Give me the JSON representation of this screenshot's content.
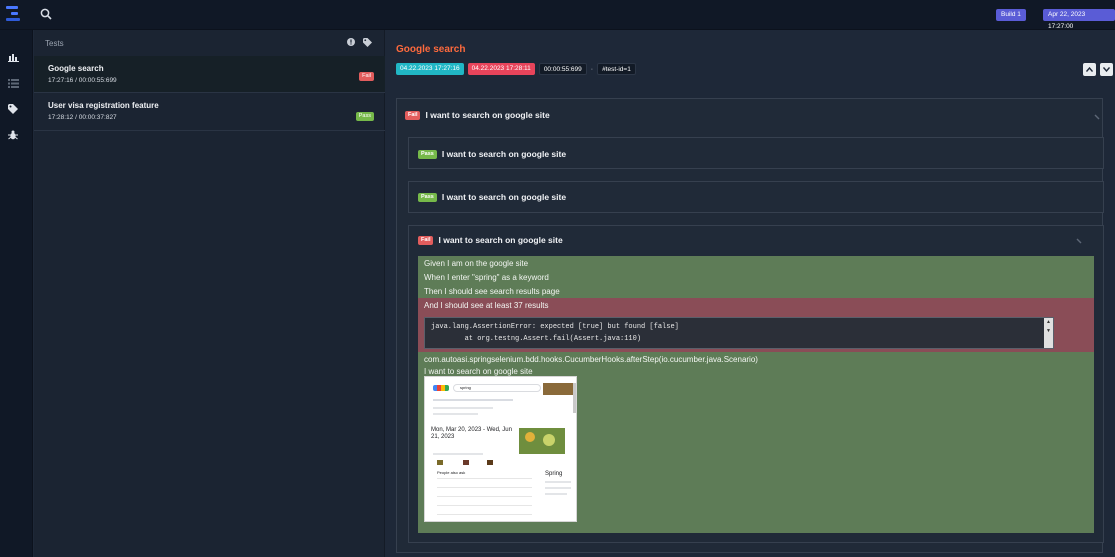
{
  "topbar": {
    "build_label": "Build 1",
    "date_label": "Apr 22, 2023 17:27:00"
  },
  "rail": {
    "icons": [
      "dashboard-icon",
      "list-icon",
      "tag-icon",
      "bug-icon"
    ]
  },
  "tests": {
    "header": "Tests",
    "items": [
      {
        "name": "Google search",
        "meta": "17:27:16 / 00:00:55:699",
        "status": "Fail"
      },
      {
        "name": "User visa registration feature",
        "meta": "17:28:12 / 00:00:37:827",
        "status": "Pass"
      }
    ]
  },
  "detail": {
    "title": "Google search",
    "start": "04.22.2023 17:27:16",
    "end": "04.22.2023 17:28:11",
    "duration": "00:00:55:699",
    "sep": "·",
    "test_id": "#test-id=1",
    "cards": [
      {
        "status": "Fail",
        "title": "I want to search on google site"
      },
      {
        "status": "Pass",
        "title": "I want to search on google site"
      },
      {
        "status": "Pass",
        "title": "I want to search on google site"
      },
      {
        "status": "Fail",
        "title": "I want to search on google site"
      }
    ],
    "steps": [
      "Given I am on the google site",
      "When I enter \"spring\" as a keyword",
      "Then I should see search results page",
      "And I should see at least 37 results"
    ],
    "error_lines": [
      "java.lang.AssertionError: expected [true] but found [false]",
      "        at org.testng.Assert.fail(Assert.java:110)"
    ],
    "hook": "com.autoasi.springselenium.bdd.hooks.CucumberHooks.afterStep(io.cucumber.java.Scenario)",
    "hook_scenario": "I want to search on google site"
  },
  "screenshot": {
    "query": "spring",
    "date_range": "Mon, Mar 20, 2023 - Wed, Jun 21, 2023",
    "side_title": "Spring",
    "people_also_ask": "People also ask"
  }
}
